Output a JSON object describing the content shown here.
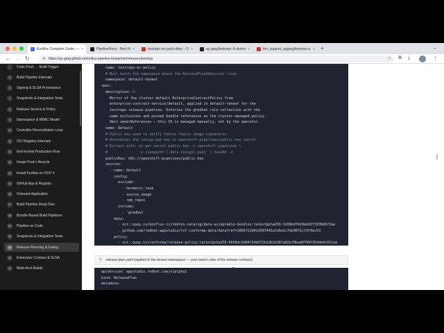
{
  "tabs": [
    {
      "label": "Konflux Complete Guide — from R",
      "color": "#4a6cf7",
      "active": true
    },
    {
      "label": "PipelineRuns - Red Hat OpenShift",
      "color": "#222222",
      "active": false
    },
    {
      "label": "testrepo-on-push-rtbnc - OpenS",
      "color": "#c0392b",
      "active": false
    },
    {
      "label": "ay-garg/testrepo: A dummy rep",
      "color": "#222222",
      "active": false
    },
    {
      "label": "thn_support_aygarg/testrepo-a",
      "color": "#c0392b",
      "active": false
    }
  ],
  "url": "https://ay-garg.github.io/konflux-pipeline-blueprints/release-planning",
  "sidebar": {
    "items": [
      {
        "num": "",
        "label": "Code Push → Build Trigger"
      },
      {
        "num": "5",
        "label": "Build Pipeline Internals"
      },
      {
        "num": "6",
        "label": "Signing & SLSA Provenance"
      },
      {
        "num": "7",
        "label": "Snapshots & Integration Tests"
      },
      {
        "num": "8",
        "label": "Release Service & Policy"
      },
      {
        "num": "9",
        "label": "Namespace & RBAC Model"
      },
      {
        "num": "10",
        "label": "Controller Reconciliation Loop"
      },
      {
        "num": "11",
        "label": "OCI Registry Internals"
      },
      {
        "num": "12",
        "label": "End-to-End Production Flow"
      },
      {
        "num": "13",
        "label": "Image Push Lifecycle"
      },
      {
        "num": "14",
        "label": "Install Konflux on OCP 4"
      },
      {
        "num": "15",
        "label": "GitHub App & Registry"
      },
      {
        "num": "16",
        "label": "Onboard Application"
      },
      {
        "num": "17",
        "label": "Build Pipeline Deep Dive"
      },
      {
        "num": "18",
        "label": "Bundle-Based Build Pipelines"
      },
      {
        "num": "19",
        "label": "Pipeline as Code"
      },
      {
        "num": "20",
        "label": "Snapshots & Integration Tests"
      },
      {
        "num": "19",
        "label": "Release Planning & Gating",
        "active": true
      },
      {
        "num": "20",
        "label": "Enterprise Contract & SLSA"
      },
      {
        "num": "21",
        "label": "Multi-Arch Builds"
      }
    ]
  },
  "code_lines": [
    "  name: testrepo-ec-policy",
    "  # Must match the namespace where the ReleasePlanAdmission lives",
    "  namespace: default-tenant",
    "spec:",
    "  description: >-",
    "    Mirror of the cluster default EnterpriseContractPolicy from",
    "    enterprise-contract-service/default, applied in default-tenant for the",
    "    testrepo release pipeline. Enforces the @redhat rule collection with the",
    "    same exclusions and pinned bundle references as the cluster-managed policy.",
    "    Omit ownerReferences — this CR is managed manually, not by the operator.",
    "  name: Default",
    "  # Public key used to verify Tekton Chains image signatures.",
    "  # References the cosign.pub key in openshift-pipelines/public-key secret.",
    "  # Extract with: oc get secret public-key -n openshift-pipelines \\",
    "  #               -o jsonpath='{.data.cosign\\.pub}' | base64 -d",
    "  publicKey: k8s://openshift-pipelines/public-key",
    "  sources:",
    "    - name: Default",
    "      config:",
    "        exclude:",
    "          - hermetic_task",
    "          - source_image",
    "          - rpm_repos",
    "        include:",
    "          - '@redhat'",
    "      data:",
    "        - oci::quay.io/konflux-ci/tekton-catalog/data-acceptable-bundles:latest@sha256:1d39bdf428eb0273938d672ae",
    "        - github.com/redhat-appstudio/tsf-conforma-data/data?ref=1066f21842d587441a7a5e1c7de9071cf3f9ec53",
    "      policy:",
    "        - oci::quay.io/conforma/release-policy:latest@sha256:4b56dc3d04f3dd372b1db1b38fa02ef8bad0799f354de0c011aa"
  ],
  "caption": {
    "icon": "⎘",
    "text": "release-plan.yaml (applied in the tenant namespace — your team's side of the release contract)"
  },
  "code2_lines": [
    "apiVersion: appstudio.redhat.com/v1alpha1",
    "kind: ReleasePlan",
    "metadata:"
  ]
}
